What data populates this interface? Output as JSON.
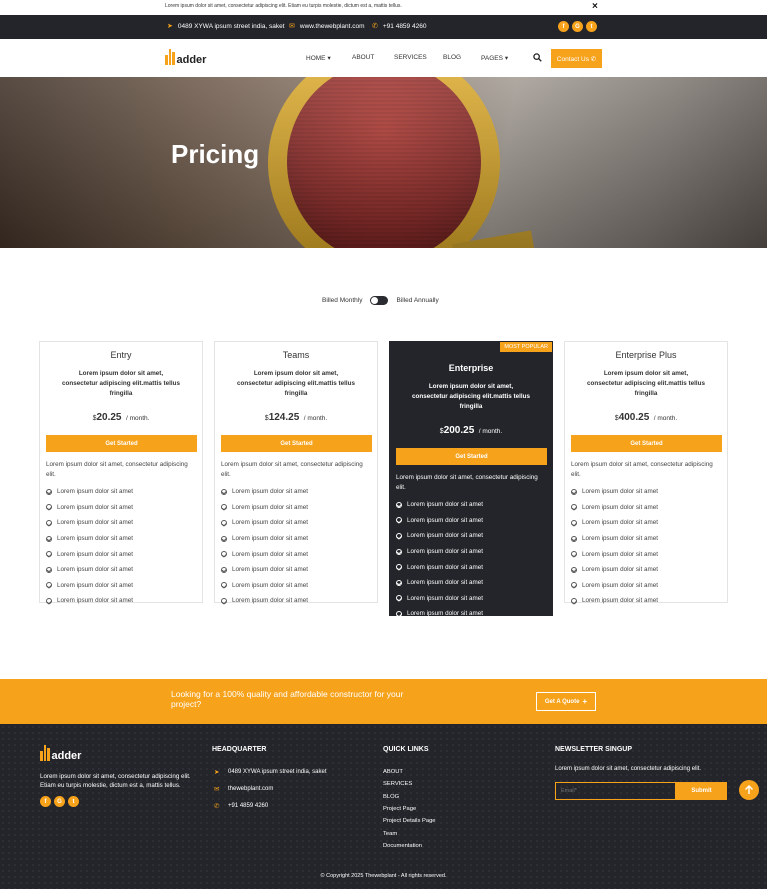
{
  "announcement": {
    "text": "Lorem ipsum dolor sit amet, consectetur adipiscing elit. Etiam eu turpis molestie, dictum est a, mattis tellus.",
    "close_icon": "×"
  },
  "topbar": {
    "address": "0489 XYWA ipsum street india, saket",
    "website": "www.thewebplant.com",
    "phone": "+91 4859 4260",
    "socials": [
      "f",
      "G",
      "t"
    ]
  },
  "brand": {
    "name": "adder",
    "accent": "#f7a21b",
    "dark": "#23252a"
  },
  "nav": {
    "items": [
      {
        "label": "HOME",
        "caret": "▾"
      },
      {
        "label": "ABOUT",
        "caret": ""
      },
      {
        "label": "SERVICES",
        "caret": ""
      },
      {
        "label": "BLOG",
        "caret": ""
      },
      {
        "label": "PAGES",
        "caret": "▾"
      }
    ],
    "cta_label": "Contact Us ✆"
  },
  "hero": {
    "title": "Pricing"
  },
  "billing": {
    "monthly_label": "Billed Monthly",
    "annually_label": "Billed Annually"
  },
  "pricing": {
    "currency": "$",
    "per": "/ month.",
    "button_label": "Get Started",
    "plans": [
      {
        "name": "Entry",
        "description": "Lorem ipsum dolor sit amet, consectetur adipiscing elit.mattis tellus fringilla",
        "price": "20.25",
        "note": "Lorem ipsum dolor sit amet, consectetur adipiscing elit.",
        "features": [
          "Lorem ipsum dolor sit amet",
          "Lorem ipsum dolor sit amet",
          "Lorem ipsum dolor sit amet",
          "Lorem ipsum dolor sit amet",
          "Lorem ipsum dolor sit amet",
          "Lorem ipsum dolor sit amet",
          "Lorem ipsum dolor sit amet",
          "Lorem ipsum dolor sit amet"
        ]
      },
      {
        "name": "Teams",
        "description": "Lorem ipsum dolor sit amet, consectetur adipiscing elit.mattis tellus fringilla",
        "price": "124.25",
        "note": "Lorem ipsum dolor sit amet, consectetur adipiscing elit.",
        "features": [
          "Lorem ipsum dolor sit amet",
          "Lorem ipsum dolor sit amet",
          "Lorem ipsum dolor sit amet",
          "Lorem ipsum dolor sit amet",
          "Lorem ipsum dolor sit amet",
          "Lorem ipsum dolor sit amet",
          "Lorem ipsum dolor sit amet",
          "Lorem ipsum dolor sit amet"
        ]
      },
      {
        "name": "Enterprise",
        "badge": "MOST POPULAR",
        "description": "Lorem ipsum dolor sit amet, consectetur adipiscing elit.mattis tellus fringilla",
        "price": "200.25",
        "note": "Lorem ipsum dolor sit amet, consectetur adipiscing elit.",
        "features": [
          "Lorem ipsum dolor sit amet",
          "Lorem ipsum dolor sit amet",
          "Lorem ipsum dolor sit amet",
          "Lorem ipsum dolor sit amet",
          "Lorem ipsum dolor sit amet",
          "Lorem ipsum dolor sit amet",
          "Lorem ipsum dolor sit amet",
          "Lorem ipsum dolor sit amet"
        ]
      },
      {
        "name": "Enterprise Plus",
        "description": "Lorem ipsum dolor sit amet, consectetur adipiscing elit.mattis tellus fringilla",
        "price": "400.25",
        "note": "Lorem ipsum dolor sit amet, consectetur adipiscing elit.",
        "features": [
          "Lorem ipsum dolor sit amet",
          "Lorem ipsum dolor sit amet",
          "Lorem ipsum dolor sit amet",
          "Lorem ipsum dolor sit amet",
          "Lorem ipsum dolor sit amet",
          "Lorem ipsum dolor sit amet",
          "Lorem ipsum dolor sit amet",
          "Lorem ipsum dolor sit amet"
        ]
      }
    ]
  },
  "cta": {
    "text": "Looking for a 100% quality and affordable constructor for your project?",
    "button_label": "Get A Quote"
  },
  "footer": {
    "about": "Lorem ipsum dolor sit amet, consectetur adipiscing elit. Etiam eu turpis molestie, dictum est a, mattis tellus.",
    "headquarter_title": "HEADQUARTER",
    "hq": {
      "address": "0489 XYWA ipsum street india, saket",
      "email": "thewebplant.com",
      "phone": "+91 4859 4260"
    },
    "quick_links_title": "QUICK LINKS",
    "quick_links": [
      "ABOUT",
      "SERVICES",
      "BLOG",
      "Project Page",
      "Project Details Page",
      "Team",
      "Documentation"
    ],
    "newsletter_title": "NEWSLETTER SINGUP",
    "newsletter_text": "Lorem ipsum dolor sit amet, consectetur adipiscing elit.",
    "email_placeholder": "Email*",
    "submit_label": "Submit",
    "copyright": "© Copyright 2025 Thewebplant - All rights reserved."
  }
}
